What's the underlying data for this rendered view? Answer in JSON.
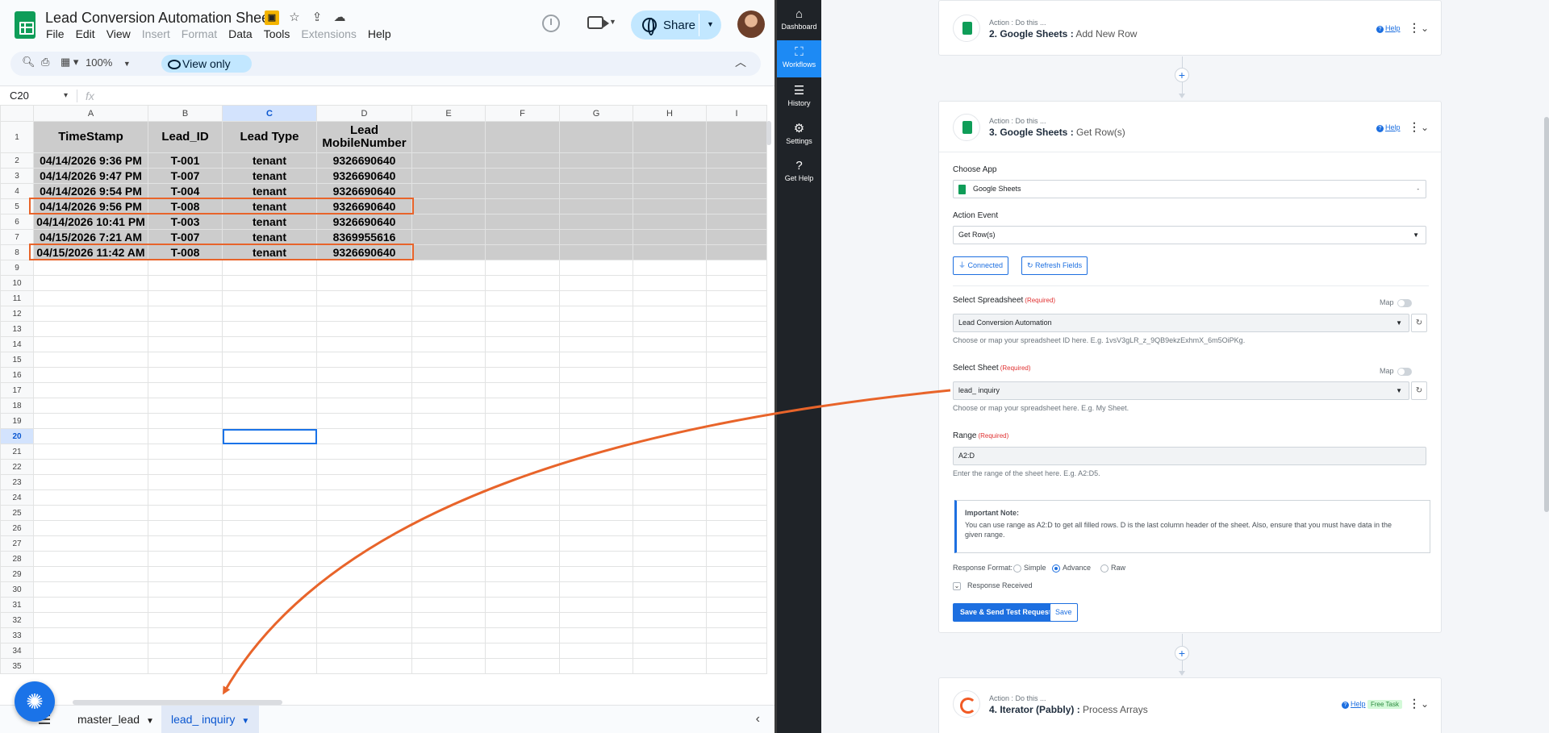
{
  "sheets": {
    "title": "Lead Conversion Automation Sheet",
    "menu": [
      "File",
      "Edit",
      "View",
      "Insert",
      "Format",
      "Data",
      "Tools",
      "Extensions",
      "Help"
    ],
    "menu_disabled": [
      "Insert",
      "Format",
      "Extensions"
    ],
    "share_label": "Share",
    "zoom": "100%",
    "view_only_label": "View only",
    "name_box": "C20",
    "fx_label": "fx",
    "columns": [
      "A",
      "B",
      "C",
      "D",
      "E",
      "F",
      "G",
      "H",
      "I"
    ],
    "selected_column": "C",
    "selected_row": 20,
    "header_row": [
      "TimeStamp",
      "Lead_ID",
      "Lead Type",
      "Lead MobileNumber"
    ],
    "rows": [
      [
        "04/14/2026 9:36 PM",
        "T-001",
        "tenant",
        "9326690640"
      ],
      [
        "04/14/2026 9:47 PM",
        "T-007",
        "tenant",
        "9326690640"
      ],
      [
        "04/14/2026 9:54 PM",
        "T-004",
        "tenant",
        "9326690640"
      ],
      [
        "04/14/2026 9:56 PM",
        "T-008",
        "tenant",
        "9326690640"
      ],
      [
        "04/14/2026 10:41 PM",
        "T-003",
        "tenant",
        "9326690640"
      ],
      [
        "04/15/2026 7:21 AM",
        "T-007",
        "tenant",
        "8369955616"
      ],
      [
        "04/15/2026 11:42 AM",
        "T-008",
        "tenant",
        "9326690640"
      ]
    ],
    "last_visible_row": 35,
    "highlighted_rows": [
      5,
      8
    ],
    "tabs": [
      {
        "label": "master_lead",
        "active": false
      },
      {
        "label": "lead_ inquiry",
        "active": true
      }
    ],
    "accent_color": "#0b57d0",
    "highlight_color": "#e8642a"
  },
  "sidebar": {
    "items": [
      {
        "label": "Dashboard",
        "icon": "home-icon",
        "glyph": "⌂",
        "active": false
      },
      {
        "label": "Workflows",
        "icon": "workflow-icon",
        "glyph": "⛶",
        "active": true
      },
      {
        "label": "History",
        "icon": "list-icon",
        "glyph": "☰",
        "active": false
      },
      {
        "label": "Settings",
        "icon": "gear-icon",
        "glyph": "⚙",
        "active": false
      },
      {
        "label": "Get Help",
        "icon": "help-icon",
        "glyph": "?",
        "active": false
      }
    ]
  },
  "pabbly": {
    "step2": {
      "prefix": "Action : Do this ...",
      "num_app": "2. Google Sheets :",
      "event": "Add New Row",
      "help": "Help"
    },
    "step3": {
      "prefix": "Action : Do this ...",
      "num_app": "3. Google Sheets :",
      "event": "Get Row(s)",
      "help": "Help",
      "choose_app_label": "Choose App",
      "choose_app_value": "Google Sheets",
      "action_event_label": "Action Event",
      "action_event_value": "Get Row(s)",
      "connected_label": "Connected",
      "refresh_label": "Refresh Fields",
      "spreadsheet_label": "Select Spreadsheet",
      "required": "(Required)",
      "map_label": "Map",
      "spreadsheet_value": "Lead Conversion Automation",
      "spreadsheet_hint": "Choose or map your spreadsheet ID here. E.g. 1vsV3gLR_z_9QB9ekzExhmX_6m5OiPKg.",
      "sheet_label": "Select Sheet",
      "sheet_value": "lead_ inquiry",
      "sheet_hint": "Choose or map your spreadsheet here. E.g. My Sheet.",
      "range_label": "Range",
      "range_value": "A2:D",
      "range_hint": "Enter the range of the sheet here. E.g. A2:D5.",
      "note_title": "Important Note:",
      "note_body": "You can use range as A2:D to get all filled rows. D is the last column header of the sheet. Also, ensure that you must have data in the given range.",
      "response_format_label": "Response Format:",
      "response_options": [
        "Simple",
        "Advance",
        "Raw"
      ],
      "response_selected": "Advance",
      "response_received_label": "Response Received",
      "save_send_label": "Save & Send Test Request",
      "save_label": "Save"
    },
    "step4": {
      "prefix": "Action : Do this ...",
      "num_app": "4. Iterator (Pabbly) :",
      "event": "Process Arrays",
      "help": "Help",
      "badge": "Free Task"
    }
  }
}
